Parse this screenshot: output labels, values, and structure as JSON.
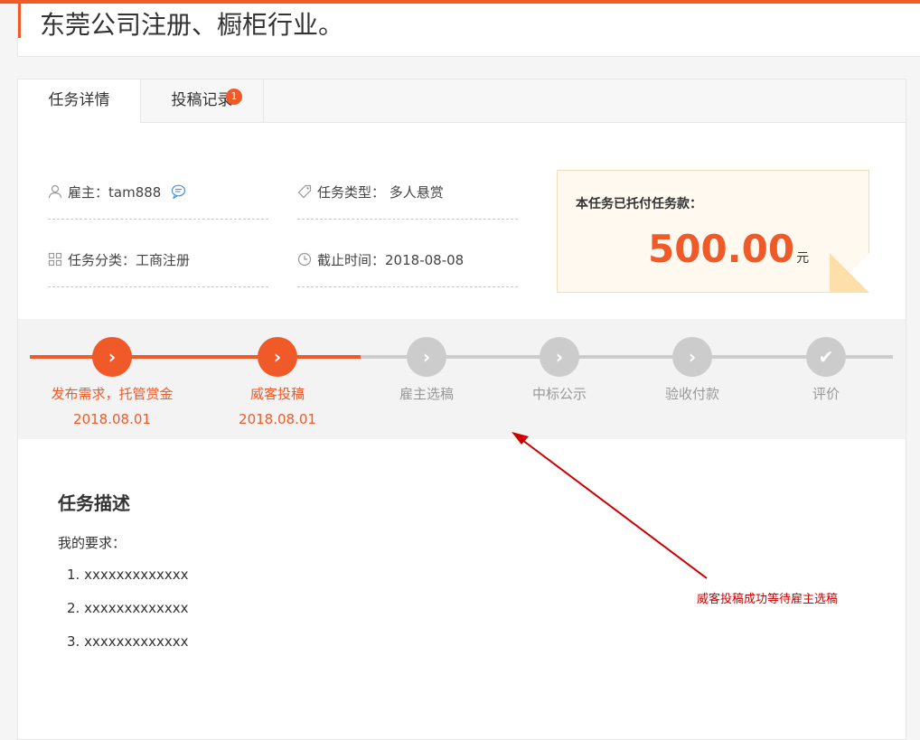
{
  "title": "东莞公司注册、橱柜行业。",
  "tabs": {
    "details": "任务详情",
    "submissions": "投稿记录",
    "submissions_badge": "1"
  },
  "info": {
    "employer_label": "雇主：",
    "employer_value": "tam888",
    "type_label": "任务类型：",
    "type_value": "多人悬赏",
    "category_label": "任务分类：",
    "category_value": "工商注册",
    "deadline_label": "截止时间：",
    "deadline_value": "2018-08-08"
  },
  "payment": {
    "label": "本任务已托付任务款：",
    "amount": "500.00",
    "unit": "元"
  },
  "progress_steps": [
    {
      "label": "发布需求，托管赏金",
      "date": "2018.08.01",
      "status": "done"
    },
    {
      "label": "威客投稿",
      "date": "2018.08.01",
      "status": "done"
    },
    {
      "label": "雇主选稿",
      "date": "",
      "status": "todo"
    },
    {
      "label": "中标公示",
      "date": "",
      "status": "todo"
    },
    {
      "label": "验收付款",
      "date": "",
      "status": "todo"
    },
    {
      "label": "评价",
      "date": "",
      "status": "todo"
    }
  ],
  "description": {
    "title": "任务描述",
    "intro": "我的要求：",
    "items": [
      "1. xxxxxxxxxxxxx",
      "2. xxxxxxxxxxxxx",
      "3. xxxxxxxxxxxxx"
    ]
  },
  "annotation": "威客投稿成功等待雇主选稿",
  "colors": {
    "accent": "#f05a28",
    "inactive": "#cccccc",
    "annotation": "#cc0000"
  },
  "icons": [
    "user-icon",
    "chat-icon",
    "tag-icon",
    "grid-icon",
    "clock-icon",
    "chevron-right-icon",
    "check-icon"
  ]
}
